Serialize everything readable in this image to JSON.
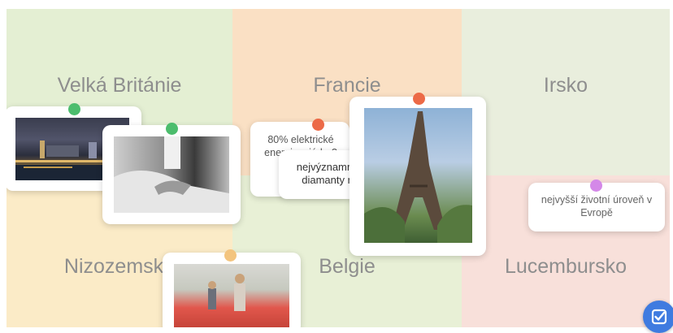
{
  "zones": {
    "uk": {
      "label": "Velká Británie",
      "color": "#e4efd3"
    },
    "france": {
      "label": "Francie",
      "color": "#fae0c4"
    },
    "ireland": {
      "label": "Irsko",
      "color": "#e9eedd"
    },
    "netherlands": {
      "label": "Nizozemsko",
      "color": "#fbebc7"
    },
    "belgium": {
      "label": "Belgie",
      "color": "#e8f0d6"
    },
    "luxembourg": {
      "label": "Lucembursko",
      "color": "#f8e0da"
    }
  },
  "cards": {
    "electricity_text": "80% elektrické energie z jádra?",
    "diamonds_text": "nejvýznamnější trh s diamanty na světě",
    "standard_text": "nejvyšší životní úroveň v Evropě"
  },
  "pins": {
    "green": "#4cbd6d",
    "red": "#ec6a47",
    "orange": "#f3c47e",
    "purple": "#d488e8"
  },
  "check_button": {
    "icon": "check-square-icon",
    "color": "#3f7be0"
  }
}
